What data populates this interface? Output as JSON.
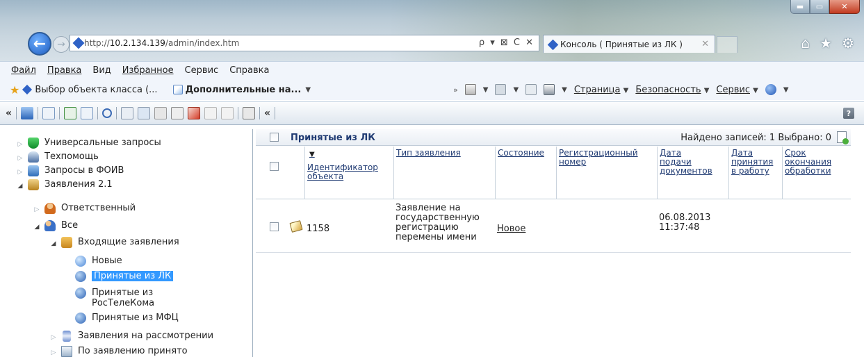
{
  "browser": {
    "url_prefix": "http://",
    "url_host": "10.2.134.139",
    "url_path": "/admin/index.htm",
    "address_tools": "ρ ▾ ⊠ C ✕",
    "tab_title": "Консоль ( Принятые из ЛК )",
    "tab_close": "✕",
    "window_buttons": {
      "minimize": "▬",
      "maximize": "▭",
      "close": "✕"
    }
  },
  "menu": {
    "items": [
      "Файл",
      "Правка",
      "Вид",
      "Избранное",
      "Сервис",
      "Справка"
    ]
  },
  "favorites": {
    "item1": "Выбор объекта класса (...",
    "item2": "Дополнительные на...",
    "page_label": "Страница",
    "security_label": "Безопасность",
    "service_label": "Сервис"
  },
  "toolbar": {
    "collapse_left": "«",
    "collapse_right": "«",
    "help": "?"
  },
  "tree": {
    "items": [
      {
        "label": "Универсальные запросы"
      },
      {
        "label": "Техпомощь"
      },
      {
        "label": "Запросы в ФОИВ"
      },
      {
        "label": "Заявления 2.1"
      },
      {
        "label": "Ответственный"
      },
      {
        "label": "Все"
      },
      {
        "label": "Входящие заявления"
      },
      {
        "label": "Новые"
      },
      {
        "label": "Принятые из ЛК"
      },
      {
        "label": "Принятые из РосТелеКома"
      },
      {
        "label": "Принятые из МФЦ"
      },
      {
        "label": "Заявления на рассмотрении"
      },
      {
        "label": "По заявлению принято"
      }
    ]
  },
  "grid": {
    "title": "Принятые из ЛК",
    "stats": "Найдено записей: 1 Выбрано: 0",
    "sort_indicator": "▼",
    "columns": [
      "Идентификатор объекта",
      "Тип заявления",
      "Состояние",
      "Регистрационный номер",
      "Дата подачи документов",
      "Дата принятия в работу",
      "Срок окончания обработки"
    ],
    "rows": [
      {
        "id": "1158",
        "type": "Заявление на государственную регистрацию перемены имени",
        "status": "Новое",
        "reg_number": "",
        "submit_date": "06.08.2013 11:37:48",
        "accept_date": "",
        "deadline": ""
      }
    ]
  }
}
